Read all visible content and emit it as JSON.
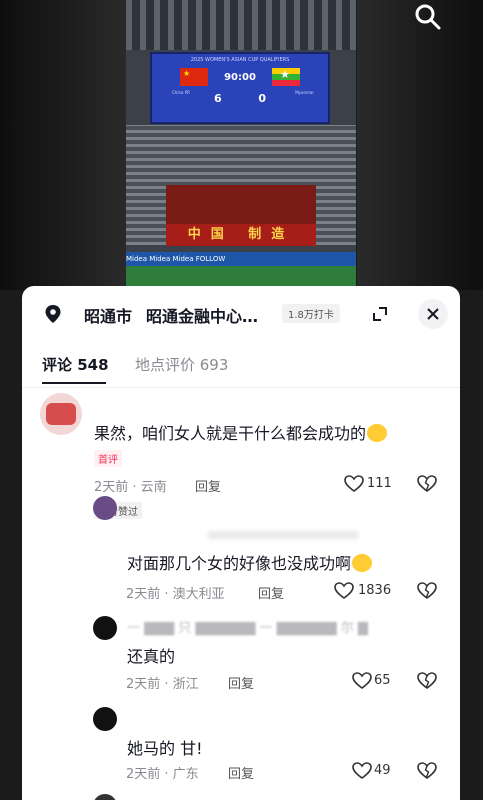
{
  "video": {
    "scoreboard_title": "2025 WOMEN'S ASIAN CUP QUALIFIERS",
    "clock": "90:00",
    "home_score": "6",
    "away_score": "0",
    "home_team": "China PR",
    "away_team": "Myanmar",
    "banner_text": "中国 制造",
    "adboard_text": "Midea   Midea   Midea   FOLLOW"
  },
  "location": {
    "city": "昭通市",
    "place": "昭通金融中心…",
    "checkins": "1.8万打卡"
  },
  "tabs": {
    "comments": "评论 548",
    "reviews": "地点评价 693"
  },
  "comments": [
    {
      "text": "果然，咱们女人就是干什么都会成功的",
      "badge": "首评",
      "meta": "2天前 · 云南",
      "reply": "回复",
      "likes": "111"
    },
    {
      "tag": "作者赞过",
      "text": "对面那几个女的好像也没成功啊",
      "meta": "2天前 · 澳大利亚",
      "reply": "回复",
      "likes": "1836"
    },
    {
      "text": "还真的",
      "meta": "2天前 · 浙江",
      "reply": "回复",
      "likes": "65"
    },
    {
      "text": "她马的 甘!",
      "meta": "2天前 · 广东",
      "reply": "回复",
      "likes": "49"
    }
  ],
  "icons": {
    "search": "search-icon",
    "pin": "location-pin-icon",
    "expand": "expand-icon",
    "close": "close-icon",
    "heart": "heart-icon",
    "dislike": "broken-heart-icon"
  },
  "colors": {
    "accent": "#fe2c55",
    "text": "#161823",
    "muted": "#8a8b91"
  }
}
